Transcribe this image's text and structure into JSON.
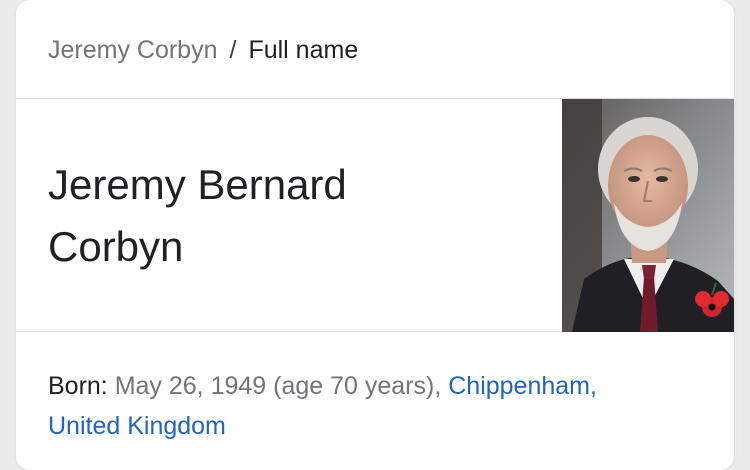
{
  "breadcrumb": {
    "parent": "Jeremy Corbyn",
    "separator": "/",
    "current": "Full name"
  },
  "answer": {
    "full_name_line1": "Jeremy Bernard",
    "full_name_line2": "Corbyn"
  },
  "image": {
    "subject": "portrait-photo"
  },
  "born": {
    "label": "Born:",
    "date": "May 26, 1949 (age 70 years),",
    "place_line1": "Chippenham,",
    "place_line2": "United Kingdom"
  },
  "colors": {
    "link": "#1f63c6",
    "muted": "#70757a",
    "text": "#202124",
    "divider": "#dadce0"
  }
}
